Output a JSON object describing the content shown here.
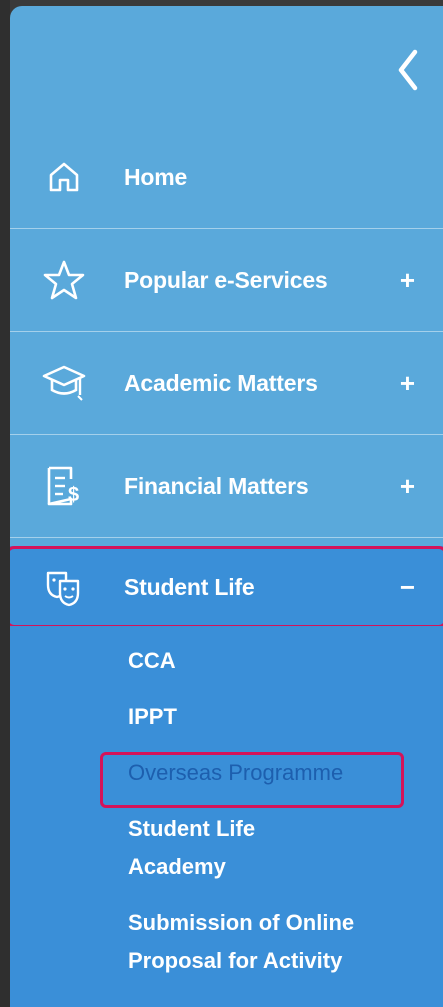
{
  "menu": {
    "items": [
      {
        "label": "Home",
        "icon": "home-icon",
        "sign": ""
      },
      {
        "label": "Popular e-Services",
        "icon": "star-icon",
        "sign": "+"
      },
      {
        "label": "Academic Matters",
        "icon": "graduation-cap-icon",
        "sign": "+"
      },
      {
        "label": "Financial Matters",
        "icon": "financial-document-icon",
        "sign": "+"
      },
      {
        "label": "Student Life",
        "icon": "theater-masks-icon",
        "sign": "−"
      }
    ],
    "student_life_sub": [
      {
        "label": "CCA"
      },
      {
        "label": "IPPT"
      },
      {
        "label": "Overseas Programme"
      },
      {
        "label": "Student Life Academy"
      },
      {
        "label": "Submission of Online Proposal for Activity"
      }
    ]
  },
  "colors": {
    "panel": "#5aa9db",
    "active": "#3a8fd8",
    "highlight": "#d4135a",
    "current_link": "#1d5fae"
  }
}
